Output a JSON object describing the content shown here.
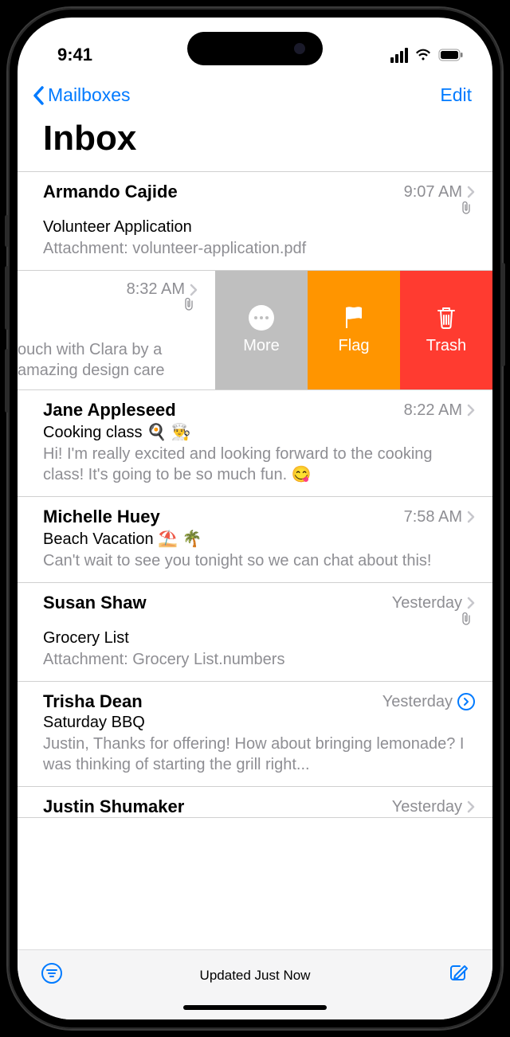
{
  "status": {
    "time": "9:41"
  },
  "nav": {
    "back_label": "Mailboxes",
    "edit_label": "Edit"
  },
  "title": "Inbox",
  "swipe_actions": {
    "more": "More",
    "flag": "Flag",
    "trash": "Trash"
  },
  "toolbar": {
    "status": "Updated Just Now"
  },
  "emails": [
    {
      "sender": "Armando Cajide",
      "time": "9:07 AM",
      "subject": "Volunteer Application",
      "preview": "Attachment: volunteer-application.pdf",
      "has_attachment": true
    },
    {
      "sender": "",
      "time": "8:32 AM",
      "subject": "",
      "preview": "ouch with Clara by a\namazing design care",
      "has_attachment": true,
      "swiped": true
    },
    {
      "sender": "Jane Appleseed",
      "time": "8:22 AM",
      "subject": "Cooking class 🍳 👨‍🍳",
      "preview": "Hi! I'm really excited and looking forward to the cooking class! It's going to be so much fun. 😋",
      "has_attachment": false
    },
    {
      "sender": "Michelle Huey",
      "time": "7:58 AM",
      "subject": "Beach Vacation ⛱️ 🌴",
      "preview": "Can't wait to see you tonight so we can chat about this!",
      "has_attachment": false
    },
    {
      "sender": "Susan Shaw",
      "time": "Yesterday",
      "subject": "Grocery List",
      "preview": "Attachment: Grocery List.numbers",
      "has_attachment": true
    },
    {
      "sender": "Trisha Dean",
      "time": "Yesterday",
      "subject": "Saturday BBQ",
      "preview": "Justin, Thanks for offering! How about bringing lemonade? I was thinking of starting the grill right...",
      "has_attachment": false,
      "thread": true
    },
    {
      "sender": "Justin Shumaker",
      "time": "Yesterday",
      "subject": "",
      "preview": "",
      "has_attachment": false
    }
  ]
}
